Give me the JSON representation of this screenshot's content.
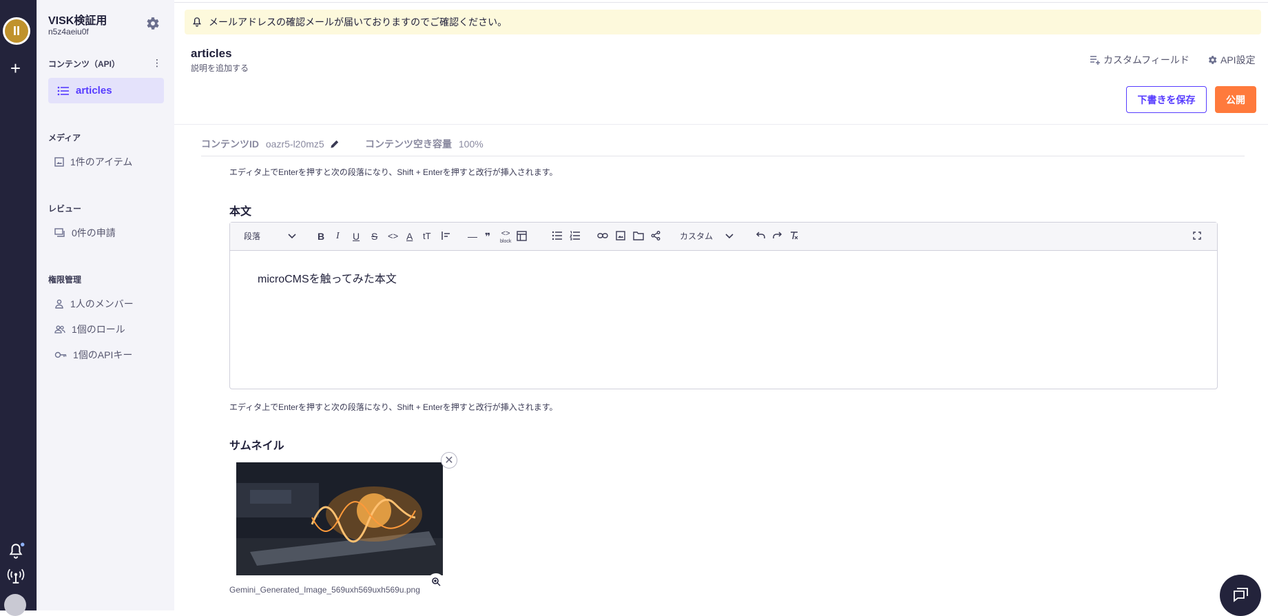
{
  "rail": {
    "logo_text": "ΙΙ",
    "plus": "+"
  },
  "sidebar": {
    "service_name": "VISK検証用",
    "service_id": "n5z4aeiu0f",
    "sections": {
      "content": "コンテンツ（API）",
      "media": "メディア",
      "review": "レビュー",
      "permissions": "権限管理"
    },
    "active_api": "articles",
    "media_item": "1件のアイテム",
    "review_item": "0件の申請",
    "members": "1人のメンバー",
    "roles": "1個のロール",
    "api_keys": "1個のAPIキー"
  },
  "banner": {
    "text": "メールアドレスの確認メールが届いておりますのでご確認ください。"
  },
  "header": {
    "title": "articles",
    "description": "説明を追加する",
    "custom_fields": "カスタムフィールド",
    "api_settings": "API設定",
    "save_draft": "下書きを保存",
    "publish": "公開"
  },
  "meta": {
    "content_id_label": "コンテンツID",
    "content_id": "oazr5-l20mz5",
    "capacity_label": "コンテンツ空き容量",
    "capacity": "100%"
  },
  "hints": {
    "top": "エディタ上でEnterを押すと次の段落になり、Shift + Enterを押すと改行が挿入されます。",
    "bottom": "エディタ上でEnterを押すと次の段落になり、Shift + Enterを押すと改行が挿入されます。"
  },
  "body_field": {
    "label": "本文",
    "toolbar": {
      "paragraph": "段落",
      "custom": "カスタム",
      "bold": "B",
      "italic": "I",
      "underline": "U",
      "strike": "S",
      "code": "<>",
      "color": "A",
      "size": "tT",
      "hr": "—",
      "quote": "❞",
      "block_code": "<>",
      "block_code_sub": "block"
    },
    "content": "microCMSを触ってみた本文"
  },
  "thumbnail_field": {
    "label": "サムネイル",
    "file_name": "Gemini_Generated_Image_569uxh569uxh569u.png"
  },
  "colors": {
    "accent": "#563bff",
    "publish": "#ff7a3c",
    "rail": "#23233b",
    "banner": "#fdf9dc"
  }
}
